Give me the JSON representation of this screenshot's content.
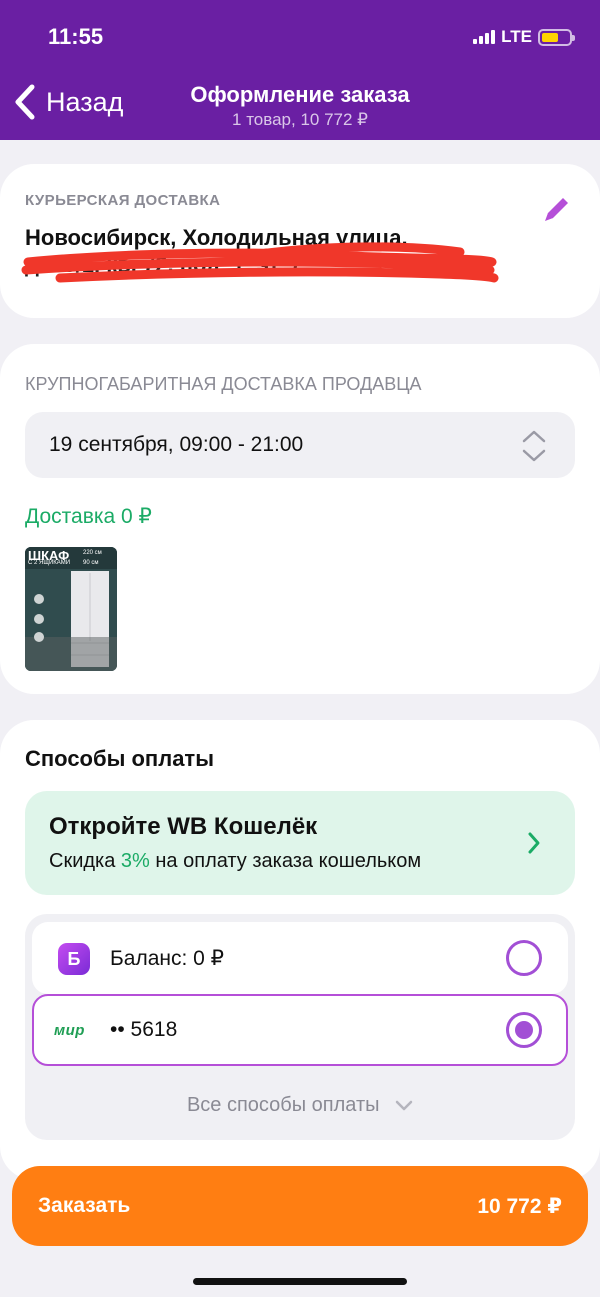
{
  "status": {
    "time": "11:55",
    "network": "LTE"
  },
  "nav": {
    "back_label": "Назад",
    "title": "Оформление заказа",
    "subtitle": "1 товар, 10 772 ₽"
  },
  "courier": {
    "caption": "Курьерская доставка",
    "address_line1": "Новосибирск, Холодильная улица,",
    "address_line2": "д. 15/1, кв. 72, под. 1, эт. 7"
  },
  "seller_delivery": {
    "caption": "Крупногабаритная доставка продавца",
    "date": "19 сентября, 09:00 - 21:00",
    "price_label": "Доставка 0 ₽",
    "product": {
      "title": "ШКАФ",
      "subtitle": "С 2 ЯЩИКАМИ",
      "size_h": "220 см",
      "size_w": "90 см"
    }
  },
  "payment": {
    "title": "Способы оплаты",
    "wallet": {
      "title": "Откройте WB Кошелёк",
      "text_before": "Скидка",
      "percent": "3%",
      "text_after": "на оплату заказа кошельком"
    },
    "methods": [
      {
        "icon": "Б",
        "label": "Баланс: 0 ₽",
        "selected": false
      },
      {
        "icon": "мир",
        "label": "•• 5618",
        "selected": true
      }
    ],
    "all_methods_label": "Все способы оплаты"
  },
  "order": {
    "button_label": "Заказать",
    "total": "10 772 ₽"
  },
  "colors": {
    "brand": "#6a1fa3",
    "accent": "#a24fd5",
    "order": "#ff7e12",
    "green": "#1bab66"
  }
}
